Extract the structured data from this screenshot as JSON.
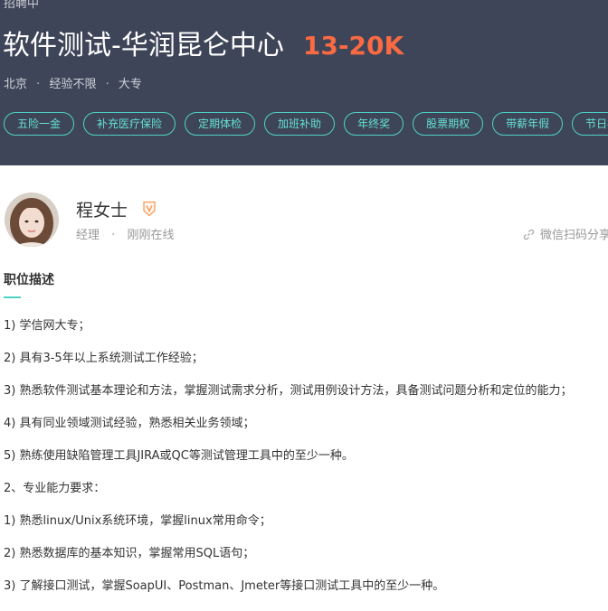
{
  "job": {
    "status": "招聘中",
    "title": "软件测试-华润昆仑中心",
    "salary": "13-20K",
    "city": "北京",
    "experience": "经验不限",
    "education": "大专",
    "dot": "·",
    "tags": [
      "五险一金",
      "补充医疗保险",
      "定期体检",
      "加班补助",
      "年终奖",
      "股票期权",
      "带薪年假",
      "节日福利"
    ]
  },
  "recruiter": {
    "name": "程女士",
    "role": "经理",
    "separator": "·",
    "online_status": "刚刚在线",
    "share_text": "微信扫码分享"
  },
  "description": {
    "title": "职位描述",
    "lines": [
      "1) 学信网大专；",
      "2) 具有3-5年以上系统测试工作经验；",
      "3) 熟悉软件测试基本理论和方法，掌握测试需求分析，测试用例设计方法，具备测试问题分析和定位的能力；",
      "4) 具有同业领域测试经验，熟悉相关业务领域；",
      "5) 熟练使用缺陷管理工具JIRA或QC等测试管理工具中的至少一种。",
      "2、专业能力要求：",
      "1) 熟悉linux/Unix系统环境，掌握linux常用命令；",
      "2) 熟悉数据库的基本知识，掌握常用SQL语句；",
      "3) 了解接口测试，掌握SoapUI、Postman、Jmeter等接口测试工具中的至少一种。"
    ]
  },
  "colors": {
    "header_bg": "#3e4558",
    "salary": "#fa6a43",
    "accent": "#4fd2c6",
    "badge": "#f59a5a"
  },
  "icons": {
    "verified": "v-badge-icon",
    "share": "link-icon"
  }
}
